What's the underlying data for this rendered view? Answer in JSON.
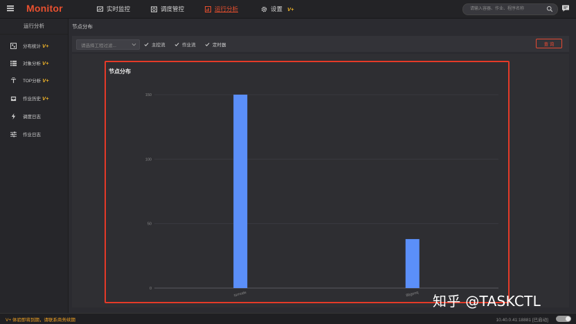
{
  "app": {
    "title": "Monitor"
  },
  "nav": {
    "items": [
      {
        "label": "实时监控",
        "icon": "monitor-icon",
        "active": false
      },
      {
        "label": "调度管控",
        "icon": "schedule-icon",
        "active": false
      },
      {
        "label": "运行分析",
        "icon": "analysis-icon",
        "active": true
      },
      {
        "label": "设置",
        "icon": "gear-icon",
        "active": false,
        "badge": "V+"
      }
    ]
  },
  "search": {
    "placeholder": "请输入容器、作业、程序名称",
    "icon": "search-icon"
  },
  "sidebar": {
    "title": "运行分析",
    "items": [
      {
        "label": "分布统计",
        "icon": "grid-icon",
        "badge": "V+"
      },
      {
        "label": "对象分析",
        "icon": "list-icon",
        "badge": "V+"
      },
      {
        "label": "TOP分析",
        "icon": "top-icon",
        "badge": "V+"
      },
      {
        "label": "作业历史",
        "icon": "inbox-icon",
        "badge": "V+"
      },
      {
        "label": "调度日志",
        "icon": "bolt-icon",
        "badge": ""
      },
      {
        "label": "作业日志",
        "icon": "sliders-icon",
        "badge": ""
      }
    ]
  },
  "breadcrumb": "节点分布",
  "filter": {
    "select_placeholder": "请选择工程过滤...",
    "checkboxes": [
      {
        "label": "主控流",
        "checked": true
      },
      {
        "label": "作业流",
        "checked": true
      },
      {
        "label": "定时器",
        "checked": true
      }
    ],
    "query_label": "查 询"
  },
  "chart_data": {
    "type": "bar",
    "title": "节点分布",
    "categories": [
      "tsrnode",
      "8bgenq"
    ],
    "values": [
      150,
      38
    ],
    "ylim": [
      0,
      150
    ],
    "yticks": [
      0,
      50,
      100,
      150
    ],
    "xlabel": "",
    "ylabel": "",
    "grid": true,
    "bar_color": "#5b8ff9"
  },
  "footer": {
    "warning": "V+ 体验即将到期，请联系商务续期",
    "address": "10.40.0.41:18881",
    "status": "[已启动]"
  },
  "watermark": "知乎 @TASKCTL",
  "colors": {
    "accent": "#e9502f",
    "badge": "#f0b429",
    "bar": "#5b8ff9"
  }
}
